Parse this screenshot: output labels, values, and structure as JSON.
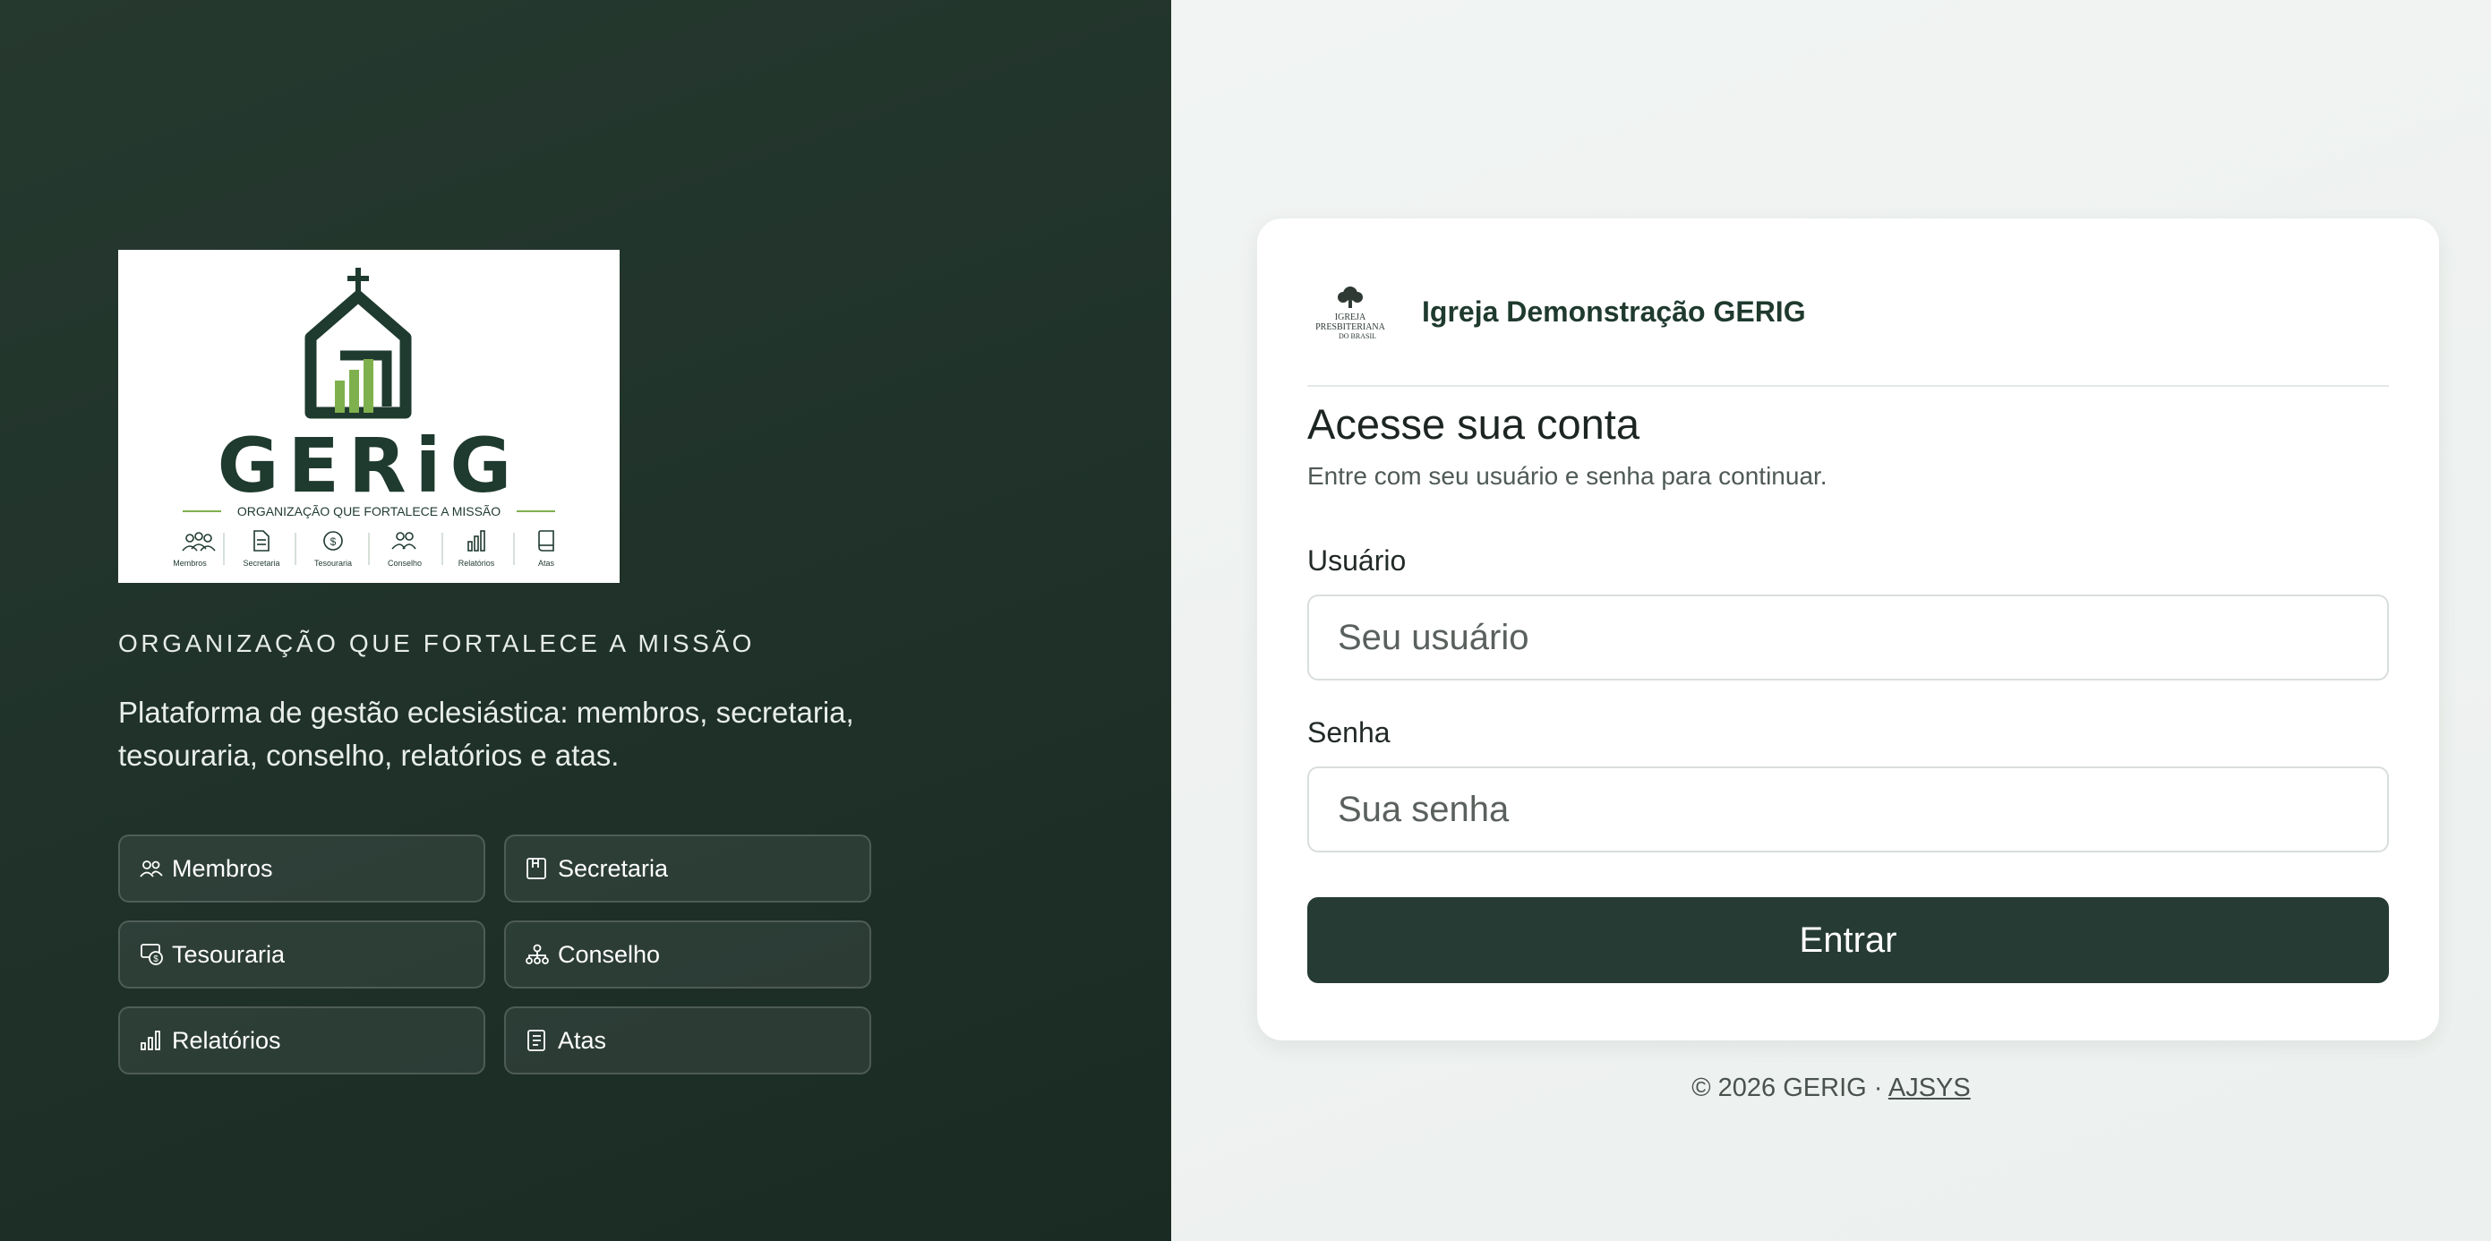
{
  "left": {
    "logo": {
      "wordmark": "GERiG",
      "tagline": "ORGANIZAÇÃO QUE FORTALECE A MISSÃO",
      "icons": [
        {
          "icon": "people-icon",
          "label": "Membros"
        },
        {
          "icon": "document-icon",
          "label": "Secretaria"
        },
        {
          "icon": "dollar-icon",
          "label": "Tesouraria"
        },
        {
          "icon": "group-icon",
          "label": "Conselho"
        },
        {
          "icon": "bar-chart-icon",
          "label": "Relatórios"
        },
        {
          "icon": "book-icon",
          "label": "Atas"
        }
      ]
    },
    "tagline": "ORGANIZAÇÃO QUE FORTALECE A MISSÃO",
    "description": "Plataforma de gestão eclesiástica: membros, secretaria, tesouraria, conselho, relatórios e atas.",
    "modules": [
      {
        "icon": "people-icon",
        "label": "Membros"
      },
      {
        "icon": "book-icon",
        "label": "Secretaria"
      },
      {
        "icon": "cash-icon",
        "label": "Tesouraria"
      },
      {
        "icon": "hierarchy-icon",
        "label": "Conselho"
      },
      {
        "icon": "bar-chart-icon",
        "label": "Relatórios"
      },
      {
        "icon": "notes-icon",
        "label": "Atas"
      }
    ],
    "colors": {
      "background": "#1f3129",
      "accent_green": "#7fb04e",
      "dark_green": "#1f3a2e"
    }
  },
  "card": {
    "church_logo": {
      "line1": "IGREJA",
      "line2": "PRESBITERIANA",
      "line3": "DO BRASIL"
    },
    "church_name": "Igreja Demonstração GERIG",
    "title": "Acesse sua conta",
    "subtitle": "Entre com seu usuário e senha para continuar.",
    "username": {
      "label": "Usuário",
      "placeholder": "Seu usuário",
      "value": ""
    },
    "password": {
      "label": "Senha",
      "placeholder": "Sua senha",
      "value": ""
    },
    "submit_label": "Entrar",
    "colors": {
      "button": "#263b33"
    }
  },
  "footer": {
    "copyright": "© 2026 GERIG · ",
    "link": "AJSYS"
  }
}
